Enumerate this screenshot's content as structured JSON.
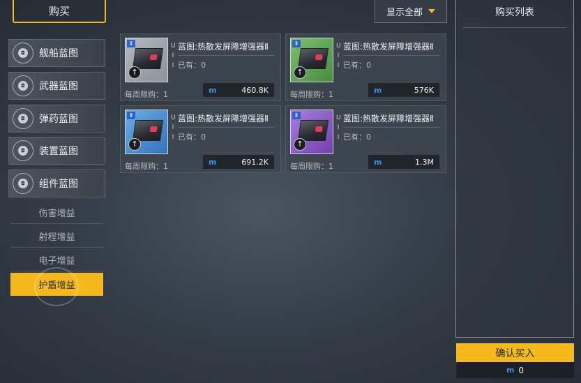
{
  "header": {
    "buy_tab": "购买",
    "filter_label": "显示全部"
  },
  "categories": [
    {
      "label": "舰船蓝图",
      "icon": "ship-icon"
    },
    {
      "label": "武器蓝图",
      "icon": "weapon-icon"
    },
    {
      "label": "弹药蓝图",
      "icon": "ammo-icon"
    },
    {
      "label": "装置蓝图",
      "icon": "device-icon"
    },
    {
      "label": "组件蓝图",
      "icon": "component-icon"
    }
  ],
  "subcategories": [
    {
      "label": "伤害增益",
      "active": false
    },
    {
      "label": "射程增益",
      "active": false
    },
    {
      "label": "电子增益",
      "active": false
    },
    {
      "label": "护盾增益",
      "active": true
    }
  ],
  "items": [
    {
      "name": "蓝图:热散发屏障增强器Ⅱ",
      "badge": "Ⅱ",
      "owned": "已有：0",
      "limit": "每周限购：1",
      "price": "460.8K",
      "color": "#8c929a"
    },
    {
      "name": "蓝图:热散发屏障增强器Ⅱ",
      "badge": "Ⅱ",
      "owned": "已有：0",
      "limit": "每周限购：1",
      "price": "576K",
      "color": "#5da152"
    },
    {
      "name": "蓝图:热散发屏障增强器Ⅱ",
      "badge": "Ⅱ",
      "owned": "已有：0",
      "limit": "每周限购：1",
      "price": "691.2K",
      "color": "#3f86c8"
    },
    {
      "name": "蓝图:热散发屏障增强器Ⅱ",
      "badge": "Ⅱ",
      "owned": "已有：0",
      "limit": "每周限购：1",
      "price": "1.3M",
      "color": "#8a4fc4"
    }
  ],
  "item_side_tag": "U I I",
  "currency_symbol": "m",
  "cart": {
    "title": "购买列表",
    "confirm_label": "确认买入",
    "total": "0"
  },
  "colors": {
    "accent": "#f5b91e",
    "currency": "#3d8ee6"
  }
}
